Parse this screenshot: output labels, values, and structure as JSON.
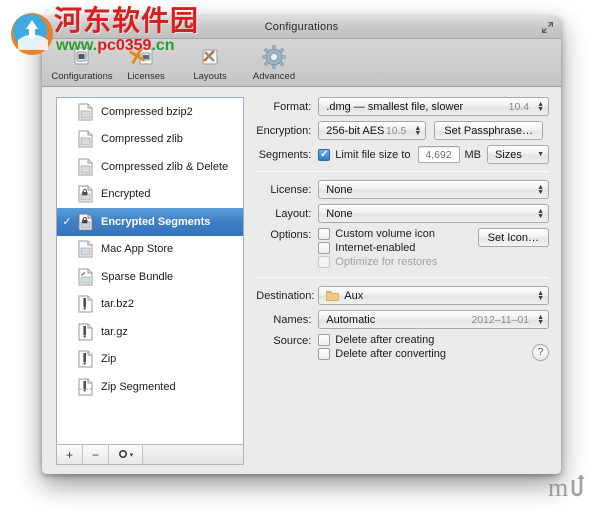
{
  "window": {
    "title": "Configurations",
    "fullscreen_icon": "expand-arrows-icon"
  },
  "toolbar": {
    "items": [
      {
        "label": "Configurations",
        "icon": "document-stack-icon"
      },
      {
        "label": "Licenses",
        "icon": "document-license-icon"
      },
      {
        "label": "Layouts",
        "icon": "tools-layout-icon"
      },
      {
        "label": "Advanced",
        "icon": "gear-icon"
      }
    ]
  },
  "config_list": {
    "items": [
      {
        "label": "Compressed bzip2",
        "icon": "document-icon",
        "selected": false,
        "checked": false
      },
      {
        "label": "Compressed zlib",
        "icon": "document-icon",
        "selected": false,
        "checked": false
      },
      {
        "label": "Compressed zlib & Delete",
        "icon": "document-icon",
        "selected": false,
        "checked": false
      },
      {
        "label": "Encrypted",
        "icon": "document-lock-icon",
        "selected": false,
        "checked": false
      },
      {
        "label": "Encrypted Segments",
        "icon": "document-lock-icon",
        "selected": true,
        "checked": true
      },
      {
        "label": "Mac App Store",
        "icon": "document-icon",
        "selected": false,
        "checked": false
      },
      {
        "label": "Sparse Bundle",
        "icon": "document-sparse-icon",
        "selected": false,
        "checked": false
      },
      {
        "label": "tar.bz2",
        "icon": "document-archive-icon",
        "selected": false,
        "checked": false
      },
      {
        "label": "tar.gz",
        "icon": "document-archive-icon",
        "selected": false,
        "checked": false
      },
      {
        "label": "Zip",
        "icon": "document-archive-icon",
        "selected": false,
        "checked": false
      },
      {
        "label": "Zip Segmented",
        "icon": "document-segmented-icon",
        "selected": false,
        "checked": false
      }
    ],
    "footer": {
      "add_label": "+",
      "remove_label": "−",
      "action_icon": "gear-icon",
      "action_arrow": "▾"
    },
    "selection_color": "#3f7fc6"
  },
  "form": {
    "format": {
      "label": "Format:",
      "value": ".dmg — smallest file, slower",
      "version": "10.4"
    },
    "encryption": {
      "label": "Encryption:",
      "value": "256-bit AES",
      "version": "10.5",
      "passphrase_button": "Set Passphrase…"
    },
    "segments": {
      "label": "Segments:",
      "limit_checkbox_label": "Limit file size to",
      "limit_checked": true,
      "size_value": "4,692",
      "unit": "MB",
      "sizes_menu": "Sizes"
    },
    "license": {
      "label": "License:",
      "value": "None"
    },
    "layout": {
      "label": "Layout:",
      "value": "None"
    },
    "options": {
      "label": "Options:",
      "items": [
        {
          "label": "Custom volume icon",
          "checked": false,
          "disabled": false
        },
        {
          "label": "Internet-enabled",
          "checked": false,
          "disabled": false
        },
        {
          "label": "Optimize for restores",
          "checked": false,
          "disabled": true
        }
      ],
      "set_icon_button": "Set Icon…"
    },
    "destination": {
      "label": "Destination:",
      "value": "Aux",
      "icon": "folder-icon"
    },
    "names": {
      "label": "Names:",
      "value": "Automatic",
      "date": "2012–11–01"
    },
    "source": {
      "label": "Source:",
      "items": [
        {
          "label": "Delete after creating",
          "checked": false
        },
        {
          "label": "Delete after converting",
          "checked": false
        }
      ]
    },
    "help_button": "?"
  },
  "watermark": {
    "site_name_cn": "河东软件园",
    "url_prefix": "www.",
    "url_mid": "pc0359",
    "url_suffix": ".cn",
    "brand_bottom": "mu"
  }
}
